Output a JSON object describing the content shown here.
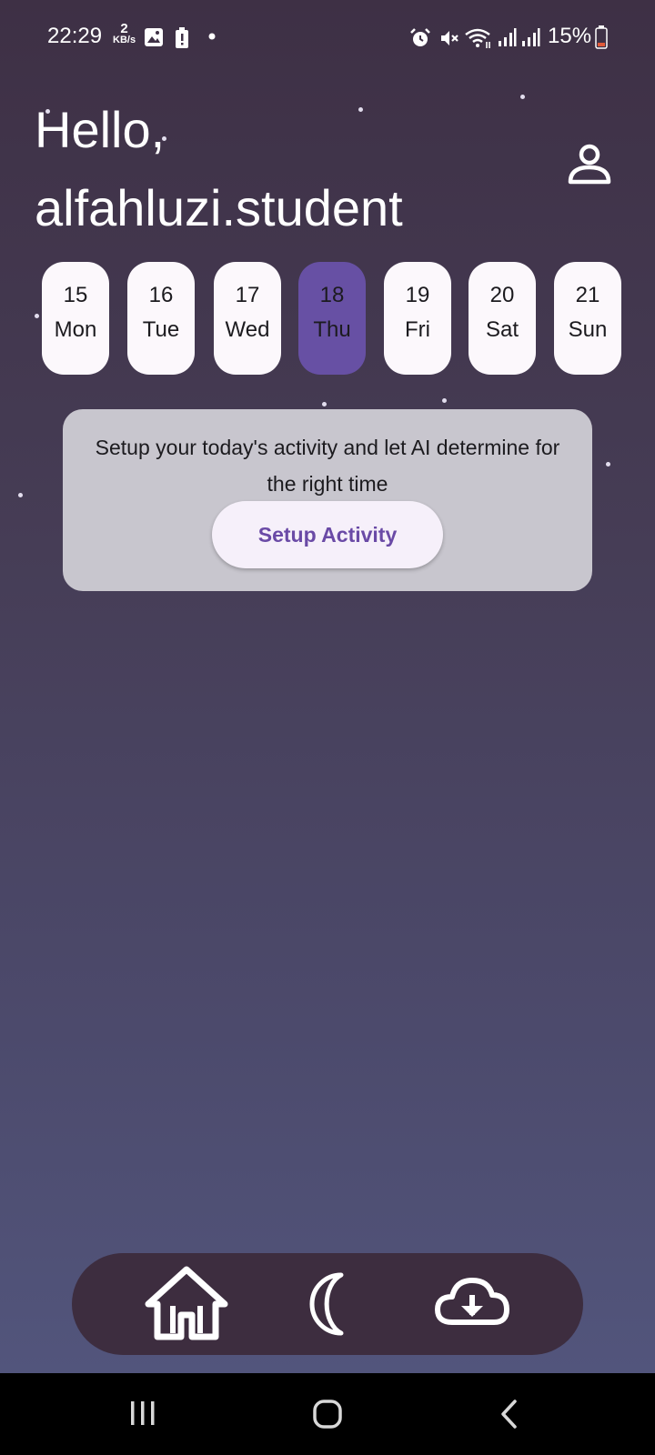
{
  "status_bar": {
    "time": "22:29",
    "network_speed_value": "2",
    "network_speed_unit": "KB/s",
    "battery_percent": "15%"
  },
  "greeting": {
    "line1": "Hello,",
    "line2": "alfahluzi.student"
  },
  "days": [
    {
      "date": "15",
      "day": "Mon",
      "selected": false
    },
    {
      "date": "16",
      "day": "Tue",
      "selected": false
    },
    {
      "date": "17",
      "day": "Wed",
      "selected": false
    },
    {
      "date": "18",
      "day": "Thu",
      "selected": true
    },
    {
      "date": "19",
      "day": "Fri",
      "selected": false
    },
    {
      "date": "20",
      "day": "Sat",
      "selected": false
    },
    {
      "date": "21",
      "day": "Sun",
      "selected": false
    }
  ],
  "activity_card": {
    "message": "Setup your today's activity and let AI determine for the right time",
    "button_label": "Setup Activity"
  },
  "bottom_nav": {
    "items": [
      {
        "icon": "home-icon"
      },
      {
        "icon": "moon-icon"
      },
      {
        "icon": "cloud-download-icon"
      }
    ]
  },
  "colors": {
    "accent": "#6750a4",
    "chip_background": "#fcf8fc",
    "card_background": "#c8c6ce",
    "nav_background": "#3d2d3f",
    "button_text": "#6a4aa6"
  }
}
